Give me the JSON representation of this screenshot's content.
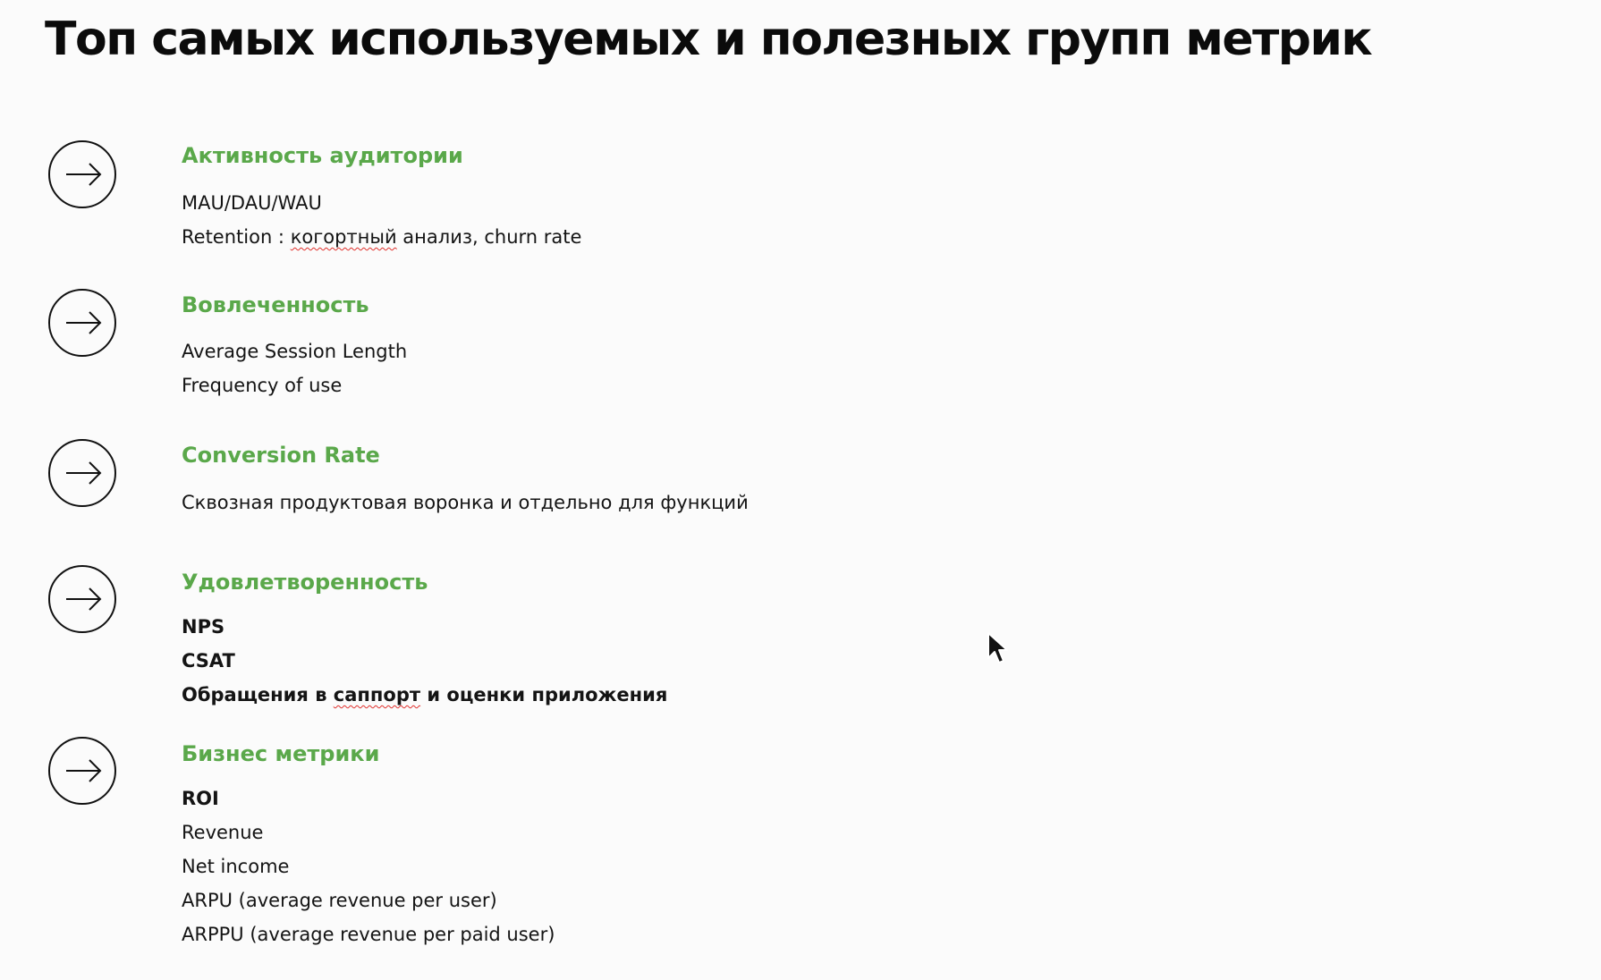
{
  "title": "Топ самых используемых и полезных групп метрик",
  "groups": [
    {
      "icon": "arrow-right-circle-icon",
      "heading": "Активность аудитории",
      "items": [
        {
          "text": "MAU/DAU/WAU"
        },
        {
          "before": "Retention : ",
          "misspelled": "когортный",
          "after": " анализ, churn rate"
        }
      ]
    },
    {
      "icon": "arrow-right-circle-icon",
      "heading": "Вовлеченность",
      "items": [
        {
          "text": "Average Session Length"
        },
        {
          "text": "Frequency of use"
        }
      ]
    },
    {
      "icon": "arrow-right-circle-icon",
      "heading": "Conversion Rate",
      "items": [
        {
          "text": "Сквозная продуктовая воронка и отдельно для функций"
        }
      ]
    },
    {
      "icon": "arrow-right-circle-icon",
      "heading": "Удовлетворенность",
      "items": [
        {
          "text": "NPS"
        },
        {
          "text": "CSAT"
        },
        {
          "before": "Обращения в ",
          "misspelled": "саппорт",
          "after": " и оценки приложения"
        }
      ]
    },
    {
      "icon": "arrow-right-circle-icon",
      "heading": "Бизнес метрики",
      "items": [
        {
          "text": "ROI"
        },
        {
          "text": "Revenue"
        },
        {
          "text": "Net income"
        },
        {
          "text": "ARPU (average revenue per user)"
        },
        {
          "text": "ARPPU (average revenue per paid user)"
        }
      ]
    }
  ],
  "colors": {
    "heading_green": "#5aa84a",
    "spellcheck_red": "#e0302c",
    "text": "#141414"
  },
  "cursor_icon": "mouse-pointer-icon"
}
